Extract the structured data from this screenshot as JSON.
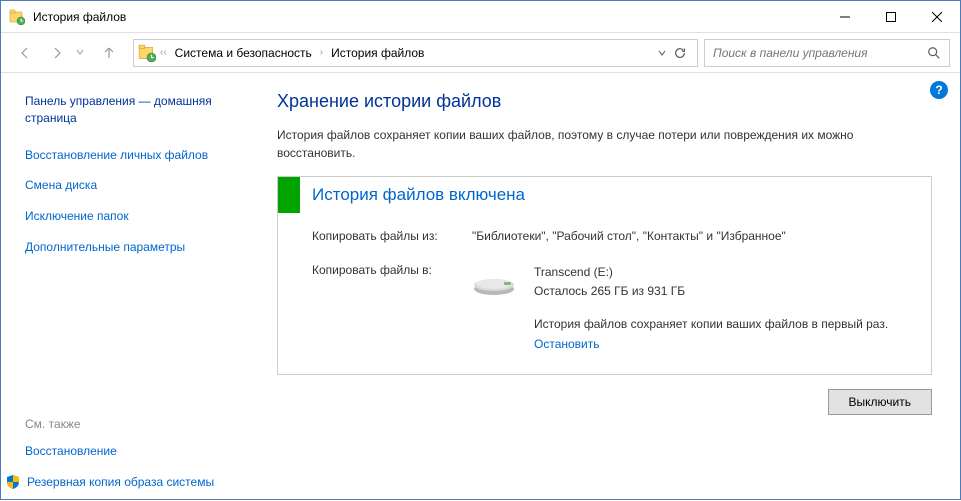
{
  "window": {
    "title": "История файлов"
  },
  "breadcrumb": {
    "items": [
      "Система и безопасность",
      "История файлов"
    ]
  },
  "search": {
    "placeholder": "Поиск в панели управления"
  },
  "sidebar": {
    "heading": "Панель управления — домашняя страница",
    "links": [
      "Восстановление личных файлов",
      "Смена диска",
      "Исключение папок",
      "Дополнительные параметры"
    ],
    "seealso_label": "См. также",
    "seealso_links": [
      "Восстановление",
      "Резервная копия образа системы"
    ]
  },
  "main": {
    "heading": "Хранение истории файлов",
    "description": "История файлов сохраняет копии ваших файлов, поэтому в случае потери или повреждения их можно восстановить.",
    "status_title": "История файлов включена",
    "copy_from_label": "Копировать файлы из:",
    "copy_from_value": "\"Библиотеки\", \"Рабочий стол\", \"Контакты\" и \"Избранное\"",
    "copy_to_label": "Копировать файлы в:",
    "dest_name": "Transcend (E:)",
    "dest_free": "Осталось 265 ГБ из 931 ГБ",
    "dest_status": "История файлов сохраняет копии ваших файлов в первый раз.",
    "stop_label": "Остановить",
    "disable_button": "Выключить"
  }
}
